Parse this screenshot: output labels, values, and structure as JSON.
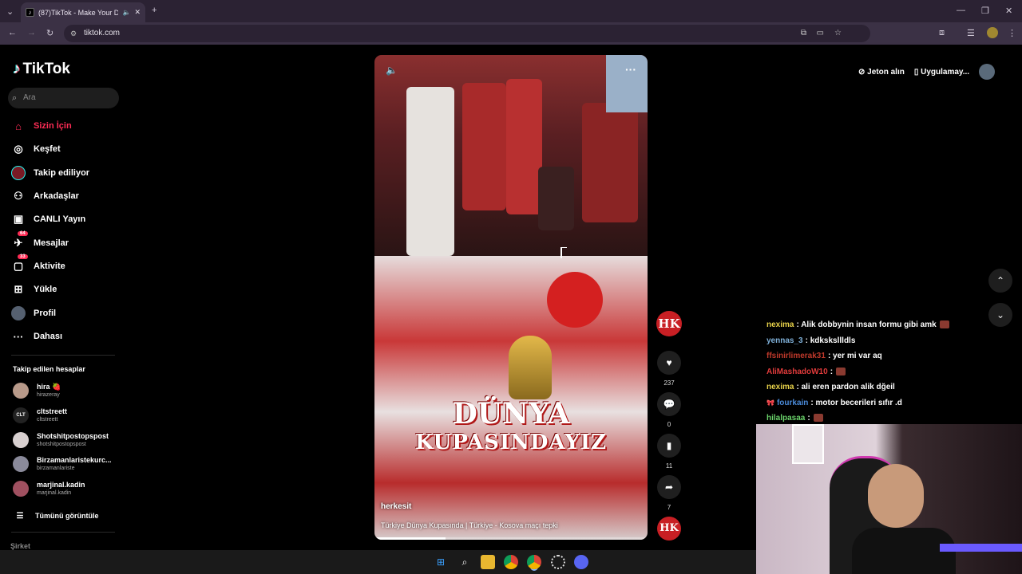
{
  "browser": {
    "tab_title": "(87)TikTok - Make Your Day",
    "tab_favicon": "tiktok-icon",
    "url": "tiktok.com",
    "new_tab": "+",
    "minimize": "—",
    "restore": "❐",
    "close": "✕"
  },
  "sidebar": {
    "logo_text": "TikTok",
    "search_placeholder": "Ara",
    "nav": [
      {
        "label": "Sizin İçin",
        "icon": "home-icon",
        "active": true
      },
      {
        "label": "Keşfet",
        "icon": "compass-icon"
      },
      {
        "label": "Takip ediliyor",
        "icon": "following-icon"
      },
      {
        "label": "Arkadaşlar",
        "icon": "friends-icon"
      },
      {
        "label": "CANLI Yayın",
        "icon": "live-icon"
      },
      {
        "label": "Mesajlar",
        "icon": "messages-icon",
        "badge": "64"
      },
      {
        "label": "Aktivite",
        "icon": "activity-icon",
        "badge": "33"
      },
      {
        "label": "Yükle",
        "icon": "upload-icon"
      },
      {
        "label": "Profil",
        "icon": "profile-icon"
      },
      {
        "label": "Dahası",
        "icon": "more-icon"
      }
    ],
    "following_header": "Takip edilen hesaplar",
    "following": [
      {
        "name": "hira 🍓",
        "handle": "hirazeray"
      },
      {
        "name": "cltstreett",
        "handle": "cltstreett",
        "avatar_text": "CLT"
      },
      {
        "name": "Shotshitpostopspost",
        "handle": "shotshitpostopspost"
      },
      {
        "name": "Birzamanlaristekurc...",
        "handle": "birzamanlariste"
      },
      {
        "name": "marjinal.kadin",
        "handle": "marjinal.kadin"
      }
    ],
    "see_all": "Tümünü görüntüle",
    "footer_partial": "Şirket"
  },
  "video": {
    "author": "herkesit",
    "description": "Türkiye Dünya Kupasında | Türkiye - Kosova maçı tepki",
    "banner_line1": "DÜNYA",
    "banner_line2": "KUPASINDAYIZ",
    "progress": 0.26
  },
  "actions": {
    "avatar_text": "HK",
    "like_count": "237",
    "comment_count": "0",
    "save_count": "11",
    "share_count": "7"
  },
  "header_right": {
    "coins": "Jeton alın",
    "app": "Uygulamay..."
  },
  "chat": [
    {
      "user": "nexima",
      "text": ": Alik dobbynin insan formu gibi amk",
      "color": "#e8d24a",
      "emote": true
    },
    {
      "user": "yennas_3",
      "text": ": kdksksllldls",
      "color": "#7fb0d8"
    },
    {
      "user": "ffsinirlimerak31",
      "text": ": yer mi var aq",
      "color": "#c0392b"
    },
    {
      "user": "AliMashadoW10",
      "text": ":",
      "color": "#e03b3b",
      "emote": true
    },
    {
      "user": "nexima",
      "text": ": ali eren pardon alik dğeil",
      "color": "#e8d24a"
    },
    {
      "user": "fourkain",
      "text": ": motor becerileri sıfır .d",
      "color": "#4a8ad8",
      "badge": "🎀"
    },
    {
      "user": "hilalpasaa",
      "text": ":",
      "color": "#6bd36b",
      "emote": true
    }
  ],
  "taskbar_icons": [
    "windows-icon",
    "search-icon",
    "folder-icon",
    "chrome-icon",
    "chrome-active-icon",
    "app-icon",
    "discord-icon"
  ],
  "colors": {
    "accent": "#fe2c55",
    "brand_red": "#c81f24"
  }
}
